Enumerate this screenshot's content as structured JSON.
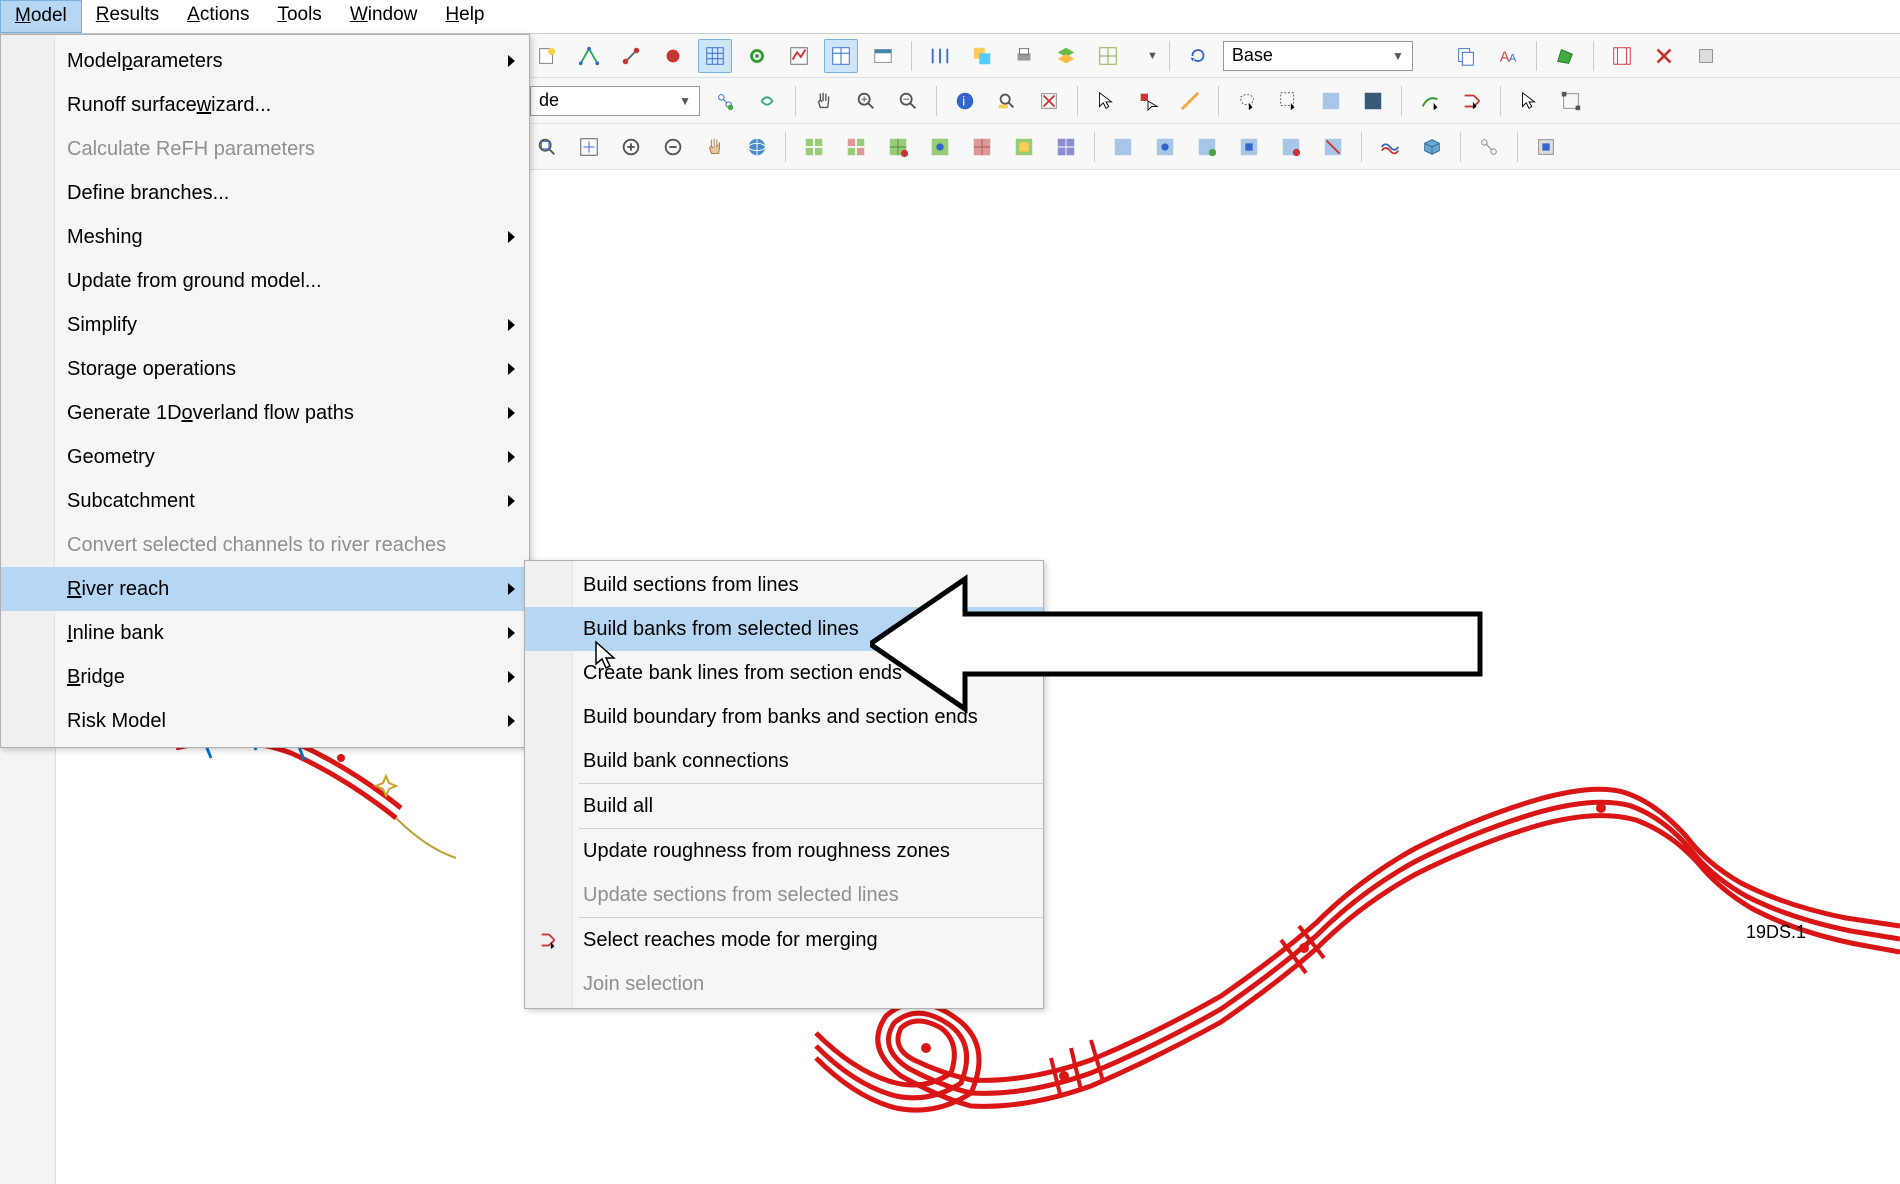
{
  "menubar": {
    "items": [
      {
        "pre": "",
        "u": "M",
        "post": "odel",
        "active": true
      },
      {
        "pre": "",
        "u": "R",
        "post": "esults"
      },
      {
        "pre": "",
        "u": "A",
        "post": "ctions"
      },
      {
        "pre": "",
        "u": "T",
        "post": "ools"
      },
      {
        "pre": "",
        "u": "W",
        "post": "indow"
      },
      {
        "pre": "",
        "u": "H",
        "post": "elp"
      }
    ]
  },
  "model_menu": [
    {
      "pre": "Model ",
      "u": "p",
      "post": "arameters",
      "sub": true
    },
    {
      "pre": "Runoff surface ",
      "u": "w",
      "post": "izard..."
    },
    {
      "pre": "Calculate ReFH parameters",
      "u": "",
      "post": "",
      "disabled": true
    },
    {
      "pre": "Define branches...",
      "u": "",
      "post": ""
    },
    {
      "pre": "Meshing",
      "u": "",
      "post": "",
      "sub": true
    },
    {
      "pre": "Update from ground model...",
      "u": "",
      "post": ""
    },
    {
      "pre": "Simplify",
      "u": "",
      "post": "",
      "sub": true
    },
    {
      "pre": "Storage operations",
      "u": "",
      "post": "",
      "sub": true
    },
    {
      "pre": "Generate 1D ",
      "u": "o",
      "post": "verland flow paths",
      "sub": true
    },
    {
      "pre": "Geometry",
      "u": "",
      "post": "",
      "sub": true
    },
    {
      "pre": "Subcatchment",
      "u": "",
      "post": "",
      "sub": true
    },
    {
      "pre": "Convert selected channels to river reaches",
      "u": "",
      "post": "",
      "disabled": true
    },
    {
      "pre": "",
      "u": "R",
      "post": "iver reach",
      "sub": true,
      "sel": true
    },
    {
      "pre": "",
      "u": "I",
      "post": "nline bank",
      "sub": true
    },
    {
      "pre": "",
      "u": "B",
      "post": "ridge",
      "sub": true
    },
    {
      "pre": "Risk Model",
      "u": "",
      "post": "",
      "sub": true
    }
  ],
  "river_submenu": [
    {
      "label": "Build sections from lines"
    },
    {
      "label": "Build banks from selected lines",
      "sel": true
    },
    {
      "label": "Create bank lines from section ends"
    },
    {
      "label": "Build boundary from banks and section ends"
    },
    {
      "label": "Build bank connections"
    },
    {
      "sep": true
    },
    {
      "label": "Build all"
    },
    {
      "sep": true
    },
    {
      "label": "Update roughness from roughness zones"
    },
    {
      "label": "Update sections from selected lines",
      "disabled": true
    },
    {
      "sep": true
    },
    {
      "label": "Select reaches mode for merging",
      "icon": true
    },
    {
      "label": "Join selection",
      "disabled": true
    }
  ],
  "toolbar": {
    "base_label": "Base",
    "de_suffix": "de"
  },
  "river_label": "19DS.1"
}
